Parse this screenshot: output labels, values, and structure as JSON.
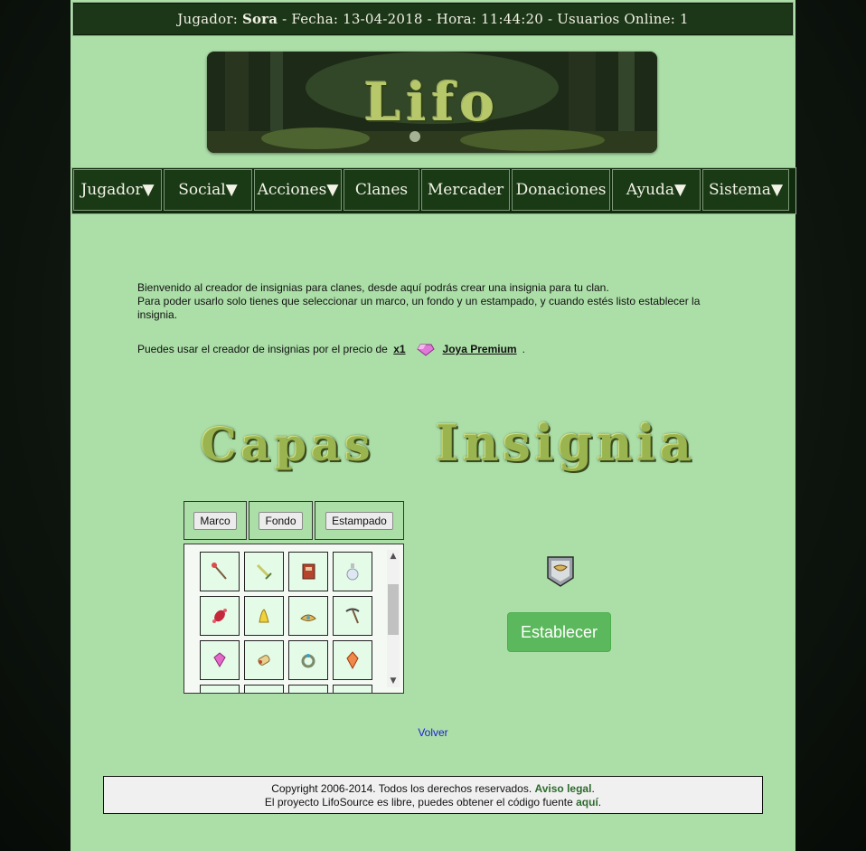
{
  "topbar": {
    "player_label": "Jugador:",
    "player_name": "Sora",
    "date_label": "- Fecha:",
    "date": "13-04-2018",
    "time_label": "- Hora:",
    "time": "11:44:20",
    "online_label": "- Usuarios Online:",
    "online": "1"
  },
  "banner": {
    "logo_text": "Lifo"
  },
  "nav": {
    "items": [
      {
        "label": "Jugador▼"
      },
      {
        "label": "Social▼"
      },
      {
        "label": "Acciones▼"
      },
      {
        "label": "Clanes"
      },
      {
        "label": "Mercader"
      },
      {
        "label": "Donaciones"
      },
      {
        "label": "Ayuda▼"
      },
      {
        "label": "Sistema▼"
      }
    ]
  },
  "intro": {
    "line1": "Bienvenido al creador de insignias para clanes, desde aquí podrás crear una insignia para tu clan.",
    "line2": "Para poder usarlo solo tienes que seleccionar un marco, un fondo y un estampado, y cuando estés listo establecer la insignia."
  },
  "price": {
    "text": "Puedes usar el creador de insignias por el precio de",
    "qty": "x1",
    "item": "Joya Premium",
    "end": "."
  },
  "headings": {
    "capas": "Capas",
    "insignia": "Insignia"
  },
  "tabs": {
    "marco": "Marco",
    "fondo": "Fondo",
    "estampado": "Estampado"
  },
  "grid": {
    "items": [
      {
        "icon": "wand-icon"
      },
      {
        "icon": "sword-icon"
      },
      {
        "icon": "book-icon"
      },
      {
        "icon": "potion-bottle-icon"
      },
      {
        "icon": "candy-icon"
      },
      {
        "icon": "banana-icon"
      },
      {
        "icon": "crown-icon"
      },
      {
        "icon": "pickaxe-icon"
      },
      {
        "icon": "gem-icon"
      },
      {
        "icon": "scroll-icon"
      },
      {
        "icon": "ring-icon"
      },
      {
        "icon": "crystal-icon"
      },
      {
        "icon": ""
      },
      {
        "icon": ""
      },
      {
        "icon": ""
      },
      {
        "icon": ""
      }
    ]
  },
  "establecer_label": "Establecer",
  "volver_label": "Volver",
  "footer": {
    "line1": "Copyright 2006-2014. Todos los derechos reservados.",
    "legal": "Aviso legal",
    "line1_end": ".",
    "line2": "El proyecto LifoSource es libre, puedes obtener el código fuente",
    "aqui": "aquí",
    "line2_end": "."
  },
  "colors": {
    "page_bg": "#acdfa8",
    "nav_bg": "#1a3a16",
    "button_green": "#5cb85c",
    "link_blue": "#1a1ad8",
    "footer_link": "#2e6b2e"
  }
}
